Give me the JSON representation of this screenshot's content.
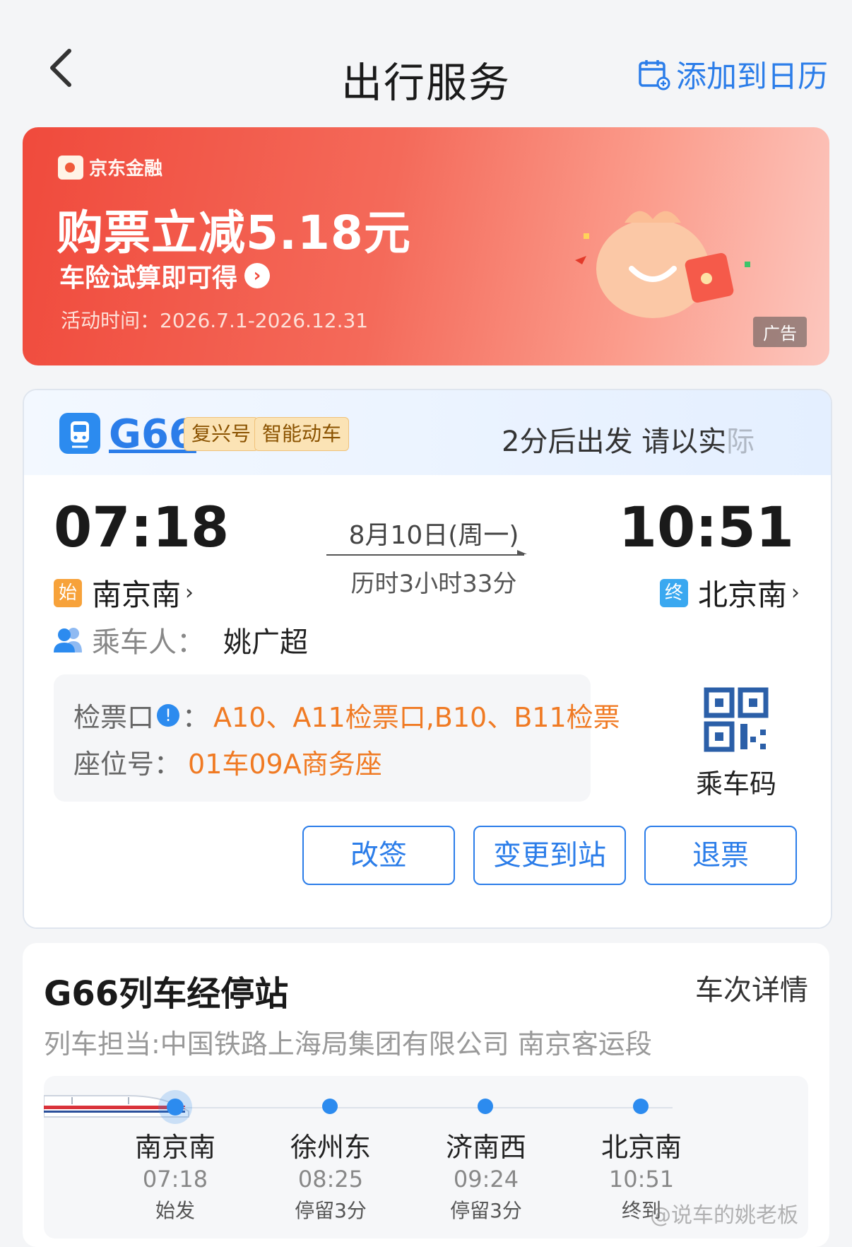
{
  "header": {
    "title": "出行服务",
    "calendar_label": "添加到日历"
  },
  "ad": {
    "brand": "京东金融",
    "headline": "购票立减5.18元",
    "subline": "车险试算即可得",
    "time": "活动时间：2026.7.1-2026.12.31",
    "tag": "广告"
  },
  "ticket": {
    "train_no": "G66",
    "tags": [
      "复兴号",
      "智能动车"
    ],
    "notice": "2分后出发 请以实",
    "notice_fade": "际",
    "dep_time": "07:18",
    "arr_time": "10:51",
    "date": "8月10日(周一)",
    "duration": "历时3小时33分",
    "dep_badge": "始",
    "dep_station": "南京南",
    "arr_badge": "终",
    "arr_station": "北京南",
    "passenger_label": "乘车人：",
    "passenger_name": "姚广超",
    "gate_label": "检票口",
    "gate_colon": "：",
    "gate_value": "A10、A11检票口,B10、B11检票",
    "seat_label": "座位号：",
    "seat_value": "01车09A商务座",
    "qr_label": "乘车码",
    "buttons": {
      "change": "改签",
      "change_station": "变更到站",
      "refund": "退票"
    }
  },
  "stops": {
    "title": "G66列车经停站",
    "detail": "车次详情",
    "operator": "列车担当:中国铁路上海局集团有限公司 南京客运段",
    "list": [
      {
        "name": "南京南",
        "time": "07:18",
        "note": "始发"
      },
      {
        "name": "徐州东",
        "time": "08:25",
        "note": "停留3分"
      },
      {
        "name": "济南西",
        "time": "09:24",
        "note": "停留3分"
      },
      {
        "name": "北京南",
        "time": "10:51",
        "note": "终到"
      }
    ]
  },
  "watermark": "@说车的姚老板",
  "colors": {
    "accent": "#2b7de9",
    "orange": "#f07a23",
    "ad_red": "#f04a3c"
  }
}
